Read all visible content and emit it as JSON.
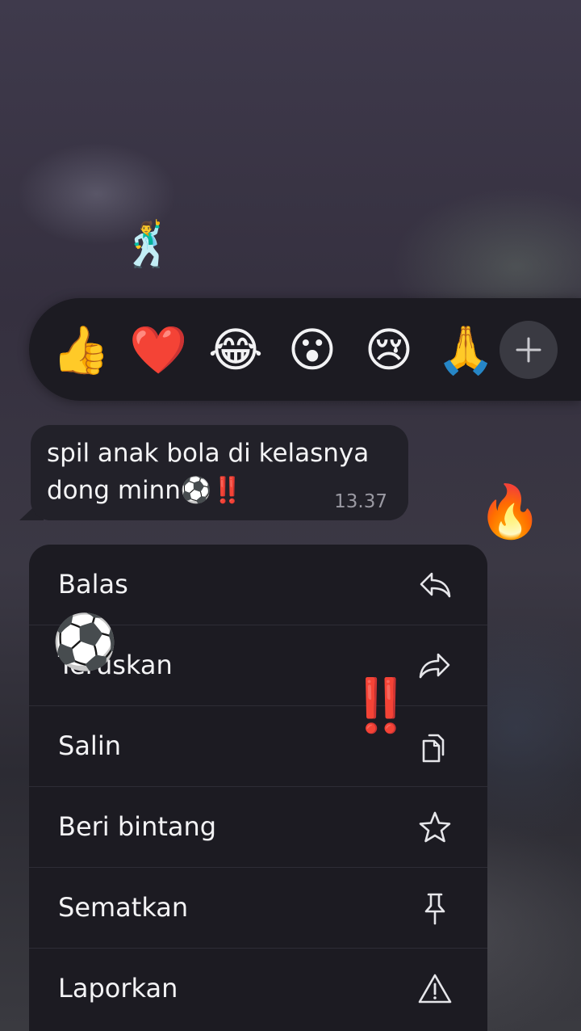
{
  "reactions": {
    "items": [
      {
        "emoji": "👍",
        "name": "thumbs-up"
      },
      {
        "emoji": "❤️",
        "name": "red-heart"
      },
      {
        "emoji": "😂",
        "name": "tears-of-joy"
      },
      {
        "emoji": "😮",
        "name": "open-mouth"
      },
      {
        "emoji": "😢",
        "name": "crying-face"
      },
      {
        "emoji": "🙏",
        "name": "folded-hands"
      }
    ],
    "more_icon": "plus-icon"
  },
  "decorations": {
    "dancer": "🕺",
    "fire": "🔥",
    "soccer_ball": "⚽",
    "double_exclamation": "‼️"
  },
  "message": {
    "text": "spil anak bola di kelasnya dong minn⚽‼️",
    "time": "13.37"
  },
  "menu": {
    "items": [
      {
        "label": "Balas",
        "icon": "reply-icon"
      },
      {
        "label": "Teruskan",
        "icon": "forward-icon"
      },
      {
        "label": "Salin",
        "icon": "copy-icon"
      },
      {
        "label": "Beri bintang",
        "icon": "star-icon"
      },
      {
        "label": "Sematkan",
        "icon": "pin-icon"
      },
      {
        "label": "Laporkan",
        "icon": "warning-icon"
      }
    ]
  },
  "colors": {
    "menu_background": "#1c1b22",
    "bubble_background": "#222129",
    "timestamp": "#9a99a2",
    "plus_button": "#3a3a42"
  }
}
